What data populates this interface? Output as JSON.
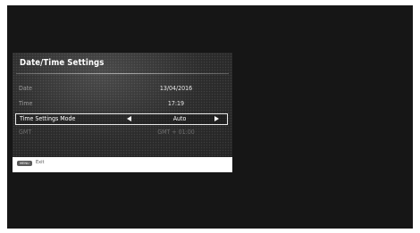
{
  "panel": {
    "title": "Date/Time Settings"
  },
  "rows": [
    {
      "label": "Date",
      "value": "13/04/2016"
    },
    {
      "label": "Time",
      "value": "17:19"
    },
    {
      "label": "Time Settings Mode",
      "value": "Auto"
    },
    {
      "label": "GMT",
      "value": "GMT + 01:00"
    }
  ],
  "footer": {
    "key_label": "MENU",
    "action_label": "Exit"
  },
  "icons": {
    "left": "arrow-left-icon",
    "right": "arrow-right-icon"
  },
  "colors": {
    "background": "#161616",
    "panel": "#2b2b2b",
    "highlight_border": "#e8e8e8",
    "footer": "#ffffff"
  }
}
